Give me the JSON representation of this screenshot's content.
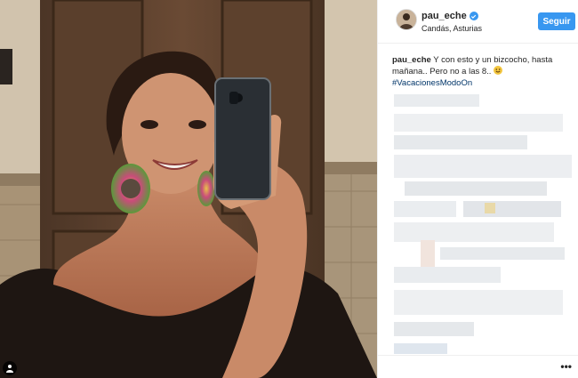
{
  "post": {
    "username": "pau_eche",
    "location": "Candás, Asturias",
    "follow_label": "Seguir",
    "caption_user": "pau_eche",
    "caption_text": "Y con esto y un bizcocho, hasta mañana.. Pero no a las 8..",
    "hashtag": "#VacacionesModoOn",
    "more_label": "•••"
  },
  "colors": {
    "accent": "#3897f0",
    "hashtag": "#003569",
    "text": "#262626"
  }
}
